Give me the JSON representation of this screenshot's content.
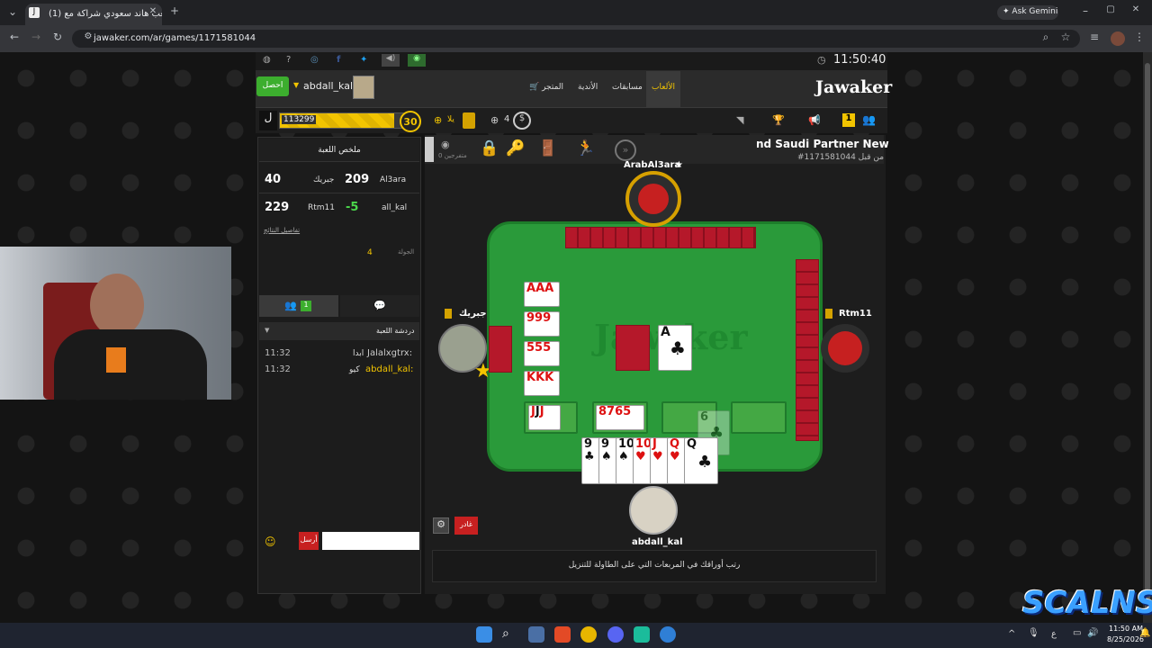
{
  "browser": {
    "tab_title": "(1) العب هاند سعودي شراكة مع",
    "new_tab": "+",
    "ask_gemini": "Ask Gemini",
    "url": "jawaker.com/ar/games/1171581044"
  },
  "site": {
    "clock": "11:50:40",
    "logo": "Jawaker",
    "nav": [
      "الألعاب",
      "مسابقات",
      "الأندية",
      "المتجر"
    ],
    "username": "abdall_kal",
    "get_button": "احصل",
    "points": "113299",
    "level": "30",
    "hand_count": "4",
    "yalla_label": "يلا",
    "notif_badge": "1"
  },
  "game": {
    "title": "nd Saudi Partner New",
    "game_id": "#1171581044 من قبل",
    "spectators": "0 متفرجين",
    "summary_title": "ملخص اللعبة",
    "scores": [
      {
        "team1": "Al3ara",
        "score1": "209",
        "team2": "جبريك",
        "score2": "40"
      },
      {
        "team1": "all_kal",
        "score1": "-5",
        "team2": "Rtm11",
        "score2": "229"
      }
    ],
    "details_link": "تفاصيل النتائج",
    "round_label": "الجولة",
    "round_value": "4",
    "chat_tab_badge": "1",
    "chat_title": "دردشة اللعبة",
    "chat": [
      {
        "user": "Jalalxgtrx:",
        "msg": "ابدا",
        "time": "11:32"
      },
      {
        "user": "abdall_kal:",
        "msg": "كيو",
        "time": "11:32"
      }
    ],
    "send_label": "أرسل",
    "players": {
      "top": "ArabAl3ara",
      "left": "جبريك",
      "right": "Rtm11",
      "bottom": "abdall_kal"
    },
    "exit_button": "غادر",
    "instruction": "رتب أوراقك في المربعات التي على الطاولة للتنزيل"
  },
  "taskbar": {
    "time": "11:50 AM",
    "date": "8/25/2026",
    "lang": "ع"
  },
  "overlay": {
    "brand": "SCALNS"
  },
  "colors": {
    "table_green": "#2a9a3a",
    "card_back": "#b5182a",
    "accent_yellow": "#f2c400",
    "get_button_green": "#3cae2e"
  }
}
